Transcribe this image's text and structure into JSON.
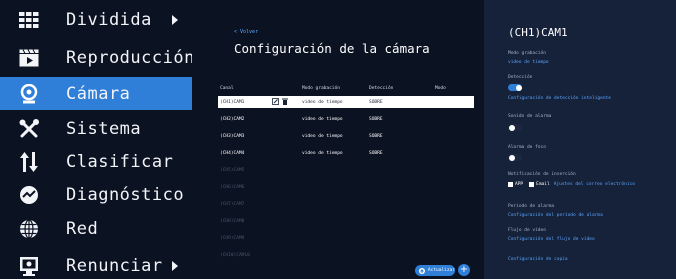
{
  "nav": {
    "items": [
      {
        "label": "Dividida",
        "icon": "grid-icon",
        "arrow": true
      },
      {
        "label": "Reproducción",
        "icon": "playback-icon",
        "arrow": false
      },
      {
        "label": "Cámara",
        "icon": "camera-icon",
        "arrow": false,
        "active": true
      },
      {
        "label": "Sistema",
        "icon": "tools-icon",
        "arrow": false
      },
      {
        "label": "Clasificar",
        "icon": "sort-icon",
        "arrow": false
      },
      {
        "label": "Diagnóstico",
        "icon": "diagnostic-icon",
        "arrow": false
      },
      {
        "label": "Red",
        "icon": "globe-icon",
        "arrow": false
      },
      {
        "label": "Renunciar",
        "icon": "logout-icon",
        "arrow": true
      }
    ]
  },
  "main": {
    "back": "< Volver",
    "title": "Configuración de la cámara",
    "columns": [
      "Canal",
      "Modo grabación",
      "Detección",
      "Modo"
    ],
    "rows": [
      {
        "canal": "(CH1)CAM1",
        "modo": "video de tiempo",
        "deteccion": "SOBRE",
        "selected": true
      },
      {
        "canal": "(CH2)CAM2",
        "modo": "video de tiempo",
        "deteccion": "SOBRE"
      },
      {
        "canal": "(CH3)CAM3",
        "modo": "video de tiempo",
        "deteccion": "SOBRE"
      },
      {
        "canal": "(CH4)CAM4",
        "modo": "video de tiempo",
        "deteccion": "SOBRE"
      },
      {
        "canal": "(CH5)CAM5",
        "disabled": true
      },
      {
        "canal": "(CH6)CAM6",
        "disabled": true
      },
      {
        "canal": "(CH7)CAM7",
        "disabled": true
      },
      {
        "canal": "(CH8)CAM8",
        "disabled": true
      },
      {
        "canal": "(CH9)CAM9",
        "disabled": true
      },
      {
        "canal": "(CH10)CAM10",
        "disabled": true
      }
    ],
    "update_label": "Actualizar"
  },
  "detail": {
    "title": "(CH1)CAM1",
    "rec_mode_label": "Modo grabación",
    "rec_mode_value": "video de tiempo",
    "detection_label": "Detección",
    "detection_on": true,
    "detection_link": "Configuración de detección inteligente",
    "alarm_sound_label": "Sonido de alarma",
    "alarm_sound_on": false,
    "alarm_light_label": "Alarma de foco",
    "alarm_light_on": false,
    "notif_label": "Notificación de inserción",
    "notif_app": "APP",
    "notif_email": "Email",
    "notif_email_link": "Ajustes del correo electrónico",
    "alarm_period_label": "Período de alarma",
    "alarm_period_link": "Configuración del período de alarma",
    "video_flow_label": "Flujo de vídeo",
    "video_flow_link": "Configuración del flujo de vídeo",
    "backup_link": "Configuración de copia"
  },
  "colors": {
    "background": "#0b1222",
    "detail_bg": "#16213a",
    "accent": "#2f7fd9",
    "link": "#5aa7ff"
  }
}
